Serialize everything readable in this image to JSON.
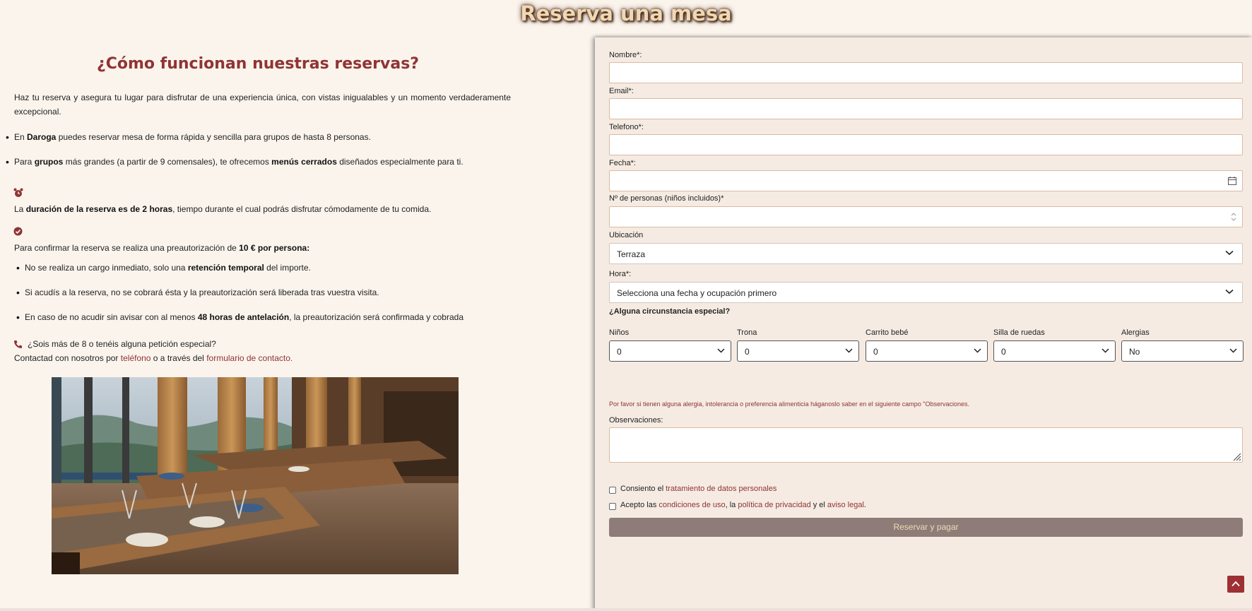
{
  "page": {
    "title": "Reserva una mesa"
  },
  "info": {
    "heading": "¿Cómo funcionan nuestras reservas?",
    "intro_line1": "Haz tu reserva y asegura tu lugar para disfrutar de una experiencia única, con vistas inigualables y un momento verdaderamente",
    "intro_line2": "excepcional.",
    "b1_pre": "En ",
    "b1_bold": "Daroga",
    "b1_post": " puedes reservar mesa de forma rápida y sencilla para grupos de hasta 8 personas.",
    "b2_pre": "Para ",
    "b2_bold1": "grupos",
    "b2_mid": " más grandes (a partir de 9 comensales), te ofrecemos ",
    "b2_bold2": "menús cerrados",
    "b2_post": " diseñados especialmente para ti.",
    "dur_pre": "La ",
    "dur_bold": "duración de la reserva es de 2 horas",
    "dur_post": ", tiempo durante el cual podrás disfrutar cómodamente de tu comida.",
    "confirm_pre": "Para confirmar la reserva se realiza una preautorización de ",
    "confirm_bold": "10 € por persona:",
    "s1_pre": "No se realiza un cargo inmediato, solo una ",
    "s1_bold": "retención temporal",
    "s1_post": " del importe.",
    "s2": "Si acudís a la reserva, no se cobrará ésta y la preautorización será liberada tras vuestra visita.",
    "s3_pre": "En caso de no acudir sin avisar con al menos ",
    "s3_bold": "48 horas de antelación",
    "s3_post": ", la preautorización será confirmada y cobrada",
    "contact_q": "¿Sois más de 8 o tenéis alguna petición especial?",
    "contact_pre": "Contactad con nosotros por ",
    "contact_link1": "teléfono",
    "contact_mid": " o a través del ",
    "contact_link2": "formulario de contacto."
  },
  "form": {
    "nombre_label": "Nombre*:",
    "email_label": "Email*:",
    "telefono_label": "Telefono*:",
    "fecha_label": "Fecha*:",
    "personas_label": "Nº de personas (niños incluidos)*",
    "ubicacion_label": "Ubicación",
    "ubicacion_value": "Terraza",
    "hora_label": "Hora*:",
    "hora_value": "Selecciona una fecha y ocupación primero",
    "special_heading": "¿Alguna circunstancia especial?",
    "ninos_label": "Niños",
    "ninos_value": "0",
    "trona_label": "Trona",
    "trona_value": "0",
    "carrito_label": "Carrito bebé",
    "carrito_value": "0",
    "silla_label": "Silla de ruedas",
    "silla_value": "0",
    "alergias_label": "Alergias",
    "alergias_value": "No",
    "allergy_note": "Por favor si tienen alguna alergia, intolerancia o preferencia alimenticia háganoslo saber en el siguiente campo \"Observaciones.",
    "obs_label": "Observaciones:",
    "consent1_pre": "Consiento el ",
    "consent1_link": "tratamiento de datos personales",
    "consent2_pre": "Acepto las ",
    "consent2_link1": "condiciones de uso",
    "consent2_mid1": ", la ",
    "consent2_link2": "política de privacidad",
    "consent2_mid2": " y el ",
    "consent2_link3": "aviso legal",
    "consent2_end": ".",
    "submit_label": "Reservar y pagar"
  },
  "colors": {
    "accent": "#8f3434",
    "background": "#faf4ec",
    "panel": "#f5ebe2",
    "button": "#8e7c78"
  }
}
